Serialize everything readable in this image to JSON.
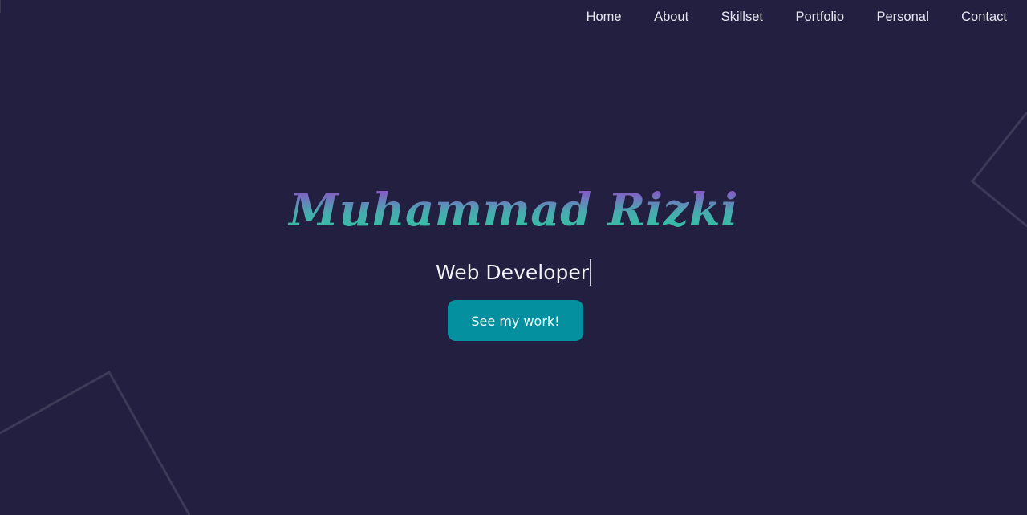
{
  "nav": {
    "items": [
      {
        "label": "Home"
      },
      {
        "label": "About"
      },
      {
        "label": "Skillset"
      },
      {
        "label": "Portfolio"
      },
      {
        "label": "Personal"
      },
      {
        "label": "Contact"
      }
    ]
  },
  "hero": {
    "name": "Muhammad Rizki",
    "subtitle": "Web Developer",
    "cta_label": "See my work!"
  },
  "colors": {
    "background": "#221f40",
    "accent_button": "#05909f",
    "title_gradient_top": "#8a55c8",
    "title_gradient_bottom": "#2cc8a0",
    "decor_stroke": "#3c3a56"
  }
}
